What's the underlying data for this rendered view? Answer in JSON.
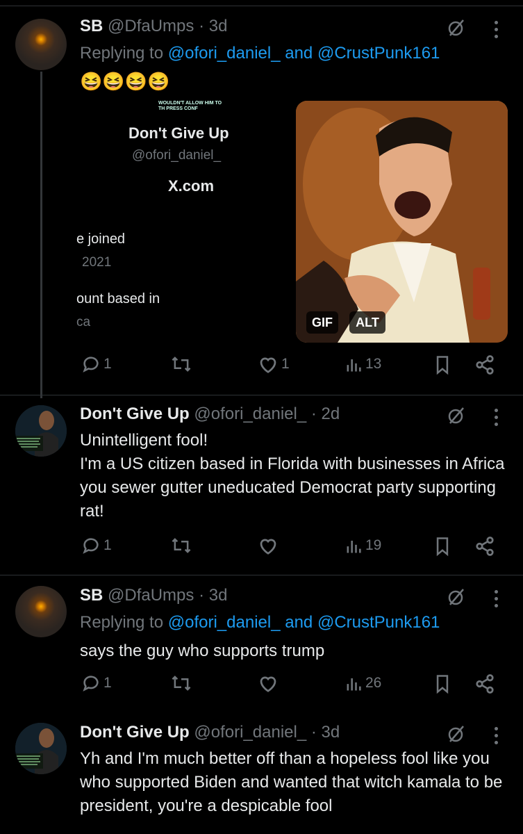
{
  "tweets": [
    {
      "name": "SB",
      "handle": "@DfaUmps",
      "time": "· 3d",
      "reply_prefix": "Replying to ",
      "reply_user1": "@ofori_daniel_",
      "reply_and": " and ",
      "reply_user2": "@CrustPunk161",
      "text": "😆😆😆😆",
      "replies": "1",
      "reposts": "",
      "likes": "1",
      "views": "13"
    },
    {
      "name": "Don't Give Up",
      "handle": "@ofori_daniel_",
      "time": "· 2d",
      "text": "Unintelligent fool!\nI'm a US citizen based in Florida with businesses in Africa you sewer gutter uneducated Democrat party supporting rat!",
      "replies": "1",
      "reposts": "",
      "likes": "",
      "views": "19"
    },
    {
      "name": "SB",
      "handle": "@DfaUmps",
      "time": "· 3d",
      "reply_prefix": "Replying to ",
      "reply_user1": "@ofori_daniel_",
      "reply_and": " and ",
      "reply_user2": "@CrustPunk161",
      "text": "says the guy who supports trump",
      "replies": "1",
      "reposts": "",
      "likes": "",
      "views": "26"
    },
    {
      "name": "Don't Give Up",
      "handle": "@ofori_daniel_",
      "time": "· 3d",
      "text": "Yh and I'm much better off than a hopeless fool like you who supported Biden and wanted that witch kamala to be president, you're a despicable fool"
    }
  ],
  "card": {
    "name": "Don't Give Up",
    "handle": "@ofori_daniel_",
    "domain": "X.com",
    "joined": "e joined",
    "year": "2021",
    "based": "ount based in",
    "loc": "ca",
    "banner_text": "WOULDN'T ALLOW HIM TO\nTH PRESS CONF"
  },
  "gif": {
    "gif_label": "GIF",
    "alt_label": "ALT"
  },
  "icons": [
    "grok-icon",
    "more-icon",
    "reply-icon",
    "repost-icon",
    "like-icon",
    "views-icon",
    "bookmark-icon",
    "share-icon"
  ]
}
